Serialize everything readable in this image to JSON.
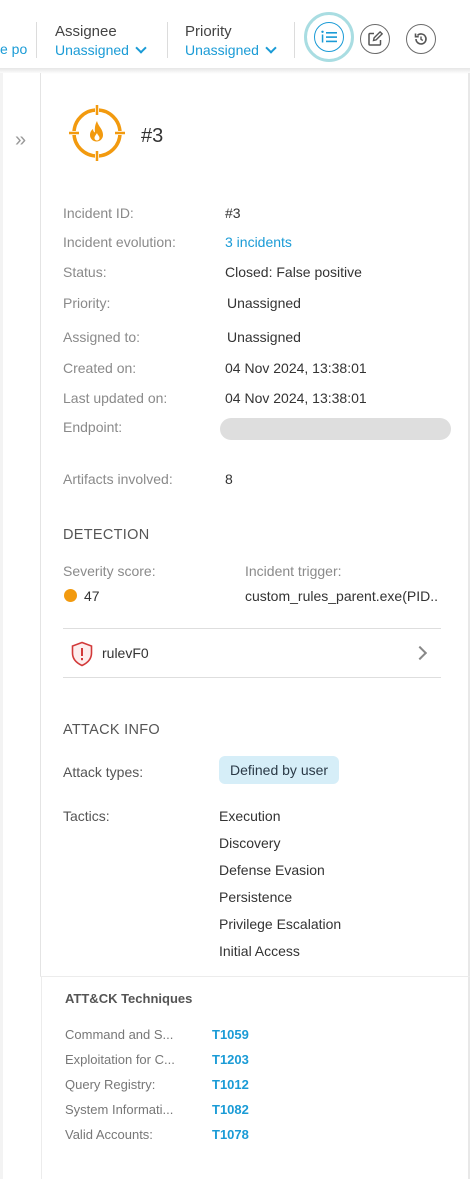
{
  "toolbar": {
    "truncated_value": "e po",
    "assignee": {
      "label": "Assignee",
      "value": "Unassigned"
    },
    "priority": {
      "label": "Priority",
      "value": "Unassigned"
    },
    "buttons": {
      "details": "info-list-icon",
      "edit": "edit-icon",
      "history": "history-icon"
    }
  },
  "incident": {
    "title": "#3",
    "icon": "fire-target-icon",
    "accent_color": "#f29a0f"
  },
  "details": [
    {
      "label": "Incident ID:",
      "value": "#3"
    },
    {
      "label": "Incident evolution:",
      "value": "3 incidents"
    },
    {
      "label": "Status:",
      "value": "Closed: False positive"
    },
    {
      "label": "Priority:",
      "value": "Unassigned"
    },
    {
      "label": "Assigned to:",
      "value": "Unassigned"
    },
    {
      "label": "Created on:",
      "value": "04 Nov 2024, 13:38:01"
    },
    {
      "label": "Last updated on:",
      "value": "04 Nov 2024, 13:38:01"
    },
    {
      "label": "Endpoint:",
      "value": ""
    },
    {
      "label": "Artifacts involved:",
      "value": "8"
    }
  ],
  "detection": {
    "heading": "DETECTION",
    "severity_label": "Severity score:",
    "severity_value": "47",
    "trigger_label": "Incident trigger:",
    "trigger_value": "custom_rules_parent.exe(PID..",
    "rule_name": "rulevF0"
  },
  "attack_info": {
    "heading": "ATTACK INFO",
    "types_label": "Attack types:",
    "types_chip": "Defined by user",
    "tactics_label": "Tactics:",
    "tactics": [
      "Execution",
      "Discovery",
      "Defense Evasion",
      "Persistence",
      "Privilege Escalation",
      "Initial Access"
    ]
  },
  "mitre": {
    "heading": "ATT&CK Techniques",
    "techniques": [
      {
        "name": "Command and S...",
        "id": "T1059"
      },
      {
        "name": "Exploitation for C...",
        "id": "T1203"
      },
      {
        "name": "Query Registry:",
        "id": "T1012"
      },
      {
        "name": "System Informati...",
        "id": "T1082"
      },
      {
        "name": "Valid Accounts:",
        "id": "T1078"
      }
    ]
  }
}
